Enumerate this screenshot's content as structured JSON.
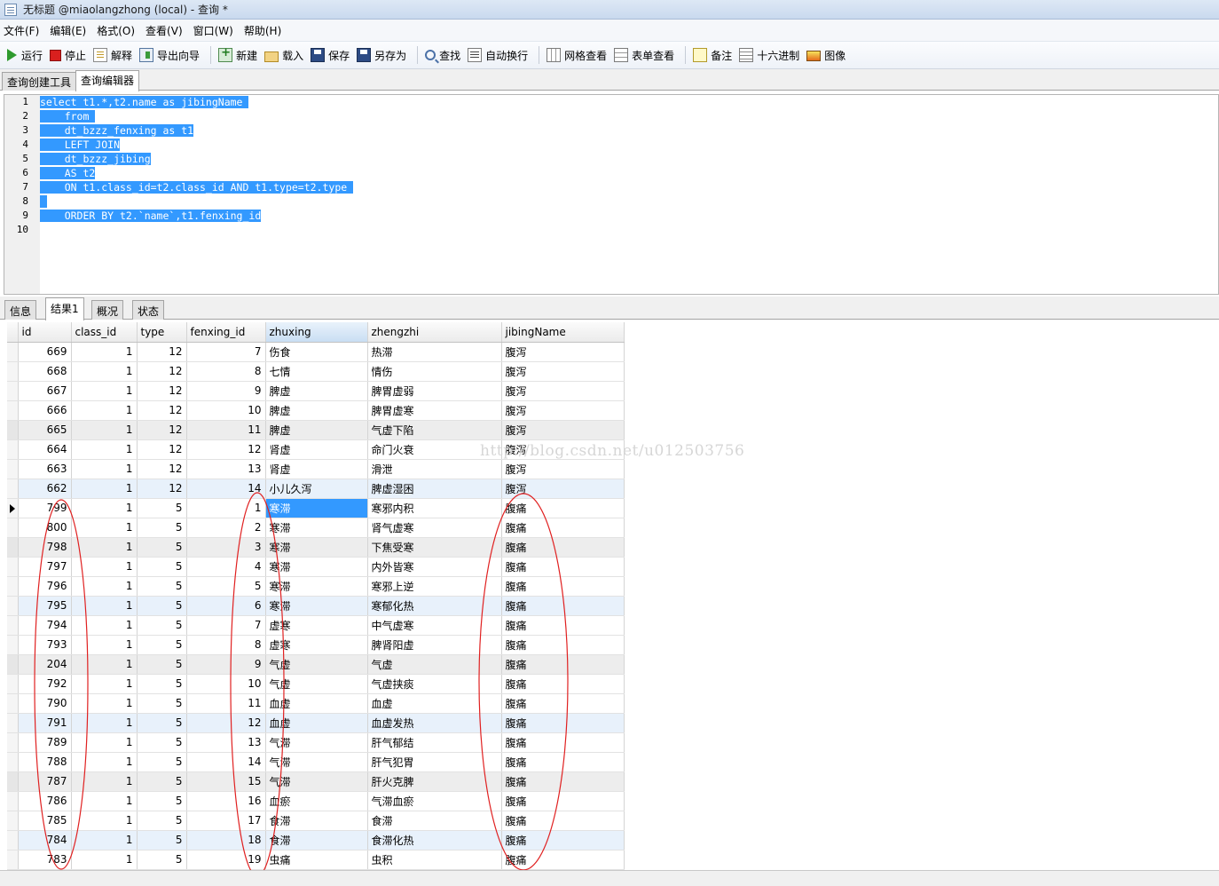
{
  "window": {
    "title": "无标题 @miaolangzhong (local) - 查询 *"
  },
  "menu": [
    "文件(F)",
    "编辑(E)",
    "格式(O)",
    "查看(V)",
    "窗口(W)",
    "帮助(H)"
  ],
  "toolbar": {
    "run": "运行",
    "stop": "停止",
    "explain": "解释",
    "export": "导出向导",
    "new": "新建",
    "load": "载入",
    "save": "保存",
    "save_as": "另存为",
    "find": "查找",
    "wrap": "自动换行",
    "grid_view": "网格查看",
    "form_view": "表单查看",
    "memo": "备注",
    "hex": "十六进制",
    "image": "图像"
  },
  "editor_tabs": [
    "查询创建工具",
    "查询编辑器"
  ],
  "sql": {
    "line_numbers": [
      "1",
      "2",
      "3",
      "4",
      "5",
      "6",
      "7",
      "8",
      "9",
      "10"
    ],
    "lines": [
      "select t1.*,t2.name as jibingName ",
      "    from ",
      "    dt_bzzz_fenxing as t1",
      "    LEFT JOIN",
      "    dt_bzzz_jibing",
      "    AS t2",
      "    ON t1.class_id=t2.class_id AND t1.type=t2.type ",
      "",
      "    ORDER BY t2.`name`,t1.fenxing_id",
      ""
    ]
  },
  "result_tabs": [
    "信息",
    "结果1",
    "概况",
    "状态"
  ],
  "grid": {
    "columns": [
      "id",
      "class_id",
      "type",
      "fenxing_id",
      "zhuxing",
      "zhengzhi",
      "jibingName"
    ],
    "rows": [
      [
        "669",
        "1",
        "12",
        "7",
        "伤食",
        "热滞",
        "腹泻"
      ],
      [
        "668",
        "1",
        "12",
        "8",
        "七情",
        "情伤",
        "腹泻"
      ],
      [
        "667",
        "1",
        "12",
        "9",
        "脾虚",
        "脾胃虚弱",
        "腹泻"
      ],
      [
        "666",
        "1",
        "12",
        "10",
        "脾虚",
        "脾胃虚寒",
        "腹泻"
      ],
      [
        "665",
        "1",
        "12",
        "11",
        "脾虚",
        "气虚下陷",
        "腹泻"
      ],
      [
        "664",
        "1",
        "12",
        "12",
        "肾虚",
        "命门火衰",
        "腹泻"
      ],
      [
        "663",
        "1",
        "12",
        "13",
        "肾虚",
        "滑泄",
        "腹泻"
      ],
      [
        "662",
        "1",
        "12",
        "14",
        "小儿久泻",
        "脾虚湿困",
        "腹泻"
      ],
      [
        "799",
        "1",
        "5",
        "1",
        "寒滞",
        "寒邪内积",
        "腹痛"
      ],
      [
        "800",
        "1",
        "5",
        "2",
        "寒滞",
        "肾气虚寒",
        "腹痛"
      ],
      [
        "798",
        "1",
        "5",
        "3",
        "寒滞",
        "下焦受寒",
        "腹痛"
      ],
      [
        "797",
        "1",
        "5",
        "4",
        "寒滞",
        "内外皆寒",
        "腹痛"
      ],
      [
        "796",
        "1",
        "5",
        "5",
        "寒滞",
        "寒邪上逆",
        "腹痛"
      ],
      [
        "795",
        "1",
        "5",
        "6",
        "寒滞",
        "寒郁化热",
        "腹痛"
      ],
      [
        "794",
        "1",
        "5",
        "7",
        "虚寒",
        "中气虚寒",
        "腹痛"
      ],
      [
        "793",
        "1",
        "5",
        "8",
        "虚寒",
        "脾肾阳虚",
        "腹痛"
      ],
      [
        "204",
        "1",
        "5",
        "9",
        "气虚",
        "气虚",
        "腹痛"
      ],
      [
        "792",
        "1",
        "5",
        "10",
        "气虚",
        "气虚挟痰",
        "腹痛"
      ],
      [
        "790",
        "1",
        "5",
        "11",
        "血虚",
        "血虚",
        "腹痛"
      ],
      [
        "791",
        "1",
        "5",
        "12",
        "血虚",
        "血虚发热",
        "腹痛"
      ],
      [
        "789",
        "1",
        "5",
        "13",
        "气滞",
        "肝气郁结",
        "腹痛"
      ],
      [
        "788",
        "1",
        "5",
        "14",
        "气滞",
        "肝气犯胃",
        "腹痛"
      ],
      [
        "787",
        "1",
        "5",
        "15",
        "气滞",
        "肝火克脾",
        "腹痛"
      ],
      [
        "786",
        "1",
        "5",
        "16",
        "血瘀",
        "气滞血瘀",
        "腹痛"
      ],
      [
        "785",
        "1",
        "5",
        "17",
        "食滞",
        "食滞",
        "腹痛"
      ],
      [
        "784",
        "1",
        "5",
        "18",
        "食滞",
        "食滞化热",
        "腹痛"
      ],
      [
        "783",
        "1",
        "5",
        "19",
        "虫痛",
        "虫积",
        "腹痛"
      ]
    ],
    "selected_row": 8,
    "selected_column": 4,
    "highlight_rows": [
      7,
      13,
      19,
      25
    ],
    "shaded_rows": [
      4,
      10,
      16,
      22
    ]
  },
  "watermark": "http://blog.csdn.net/u012503756",
  "colors": {
    "selection": "#3399ff",
    "annotation": "#e02020"
  }
}
